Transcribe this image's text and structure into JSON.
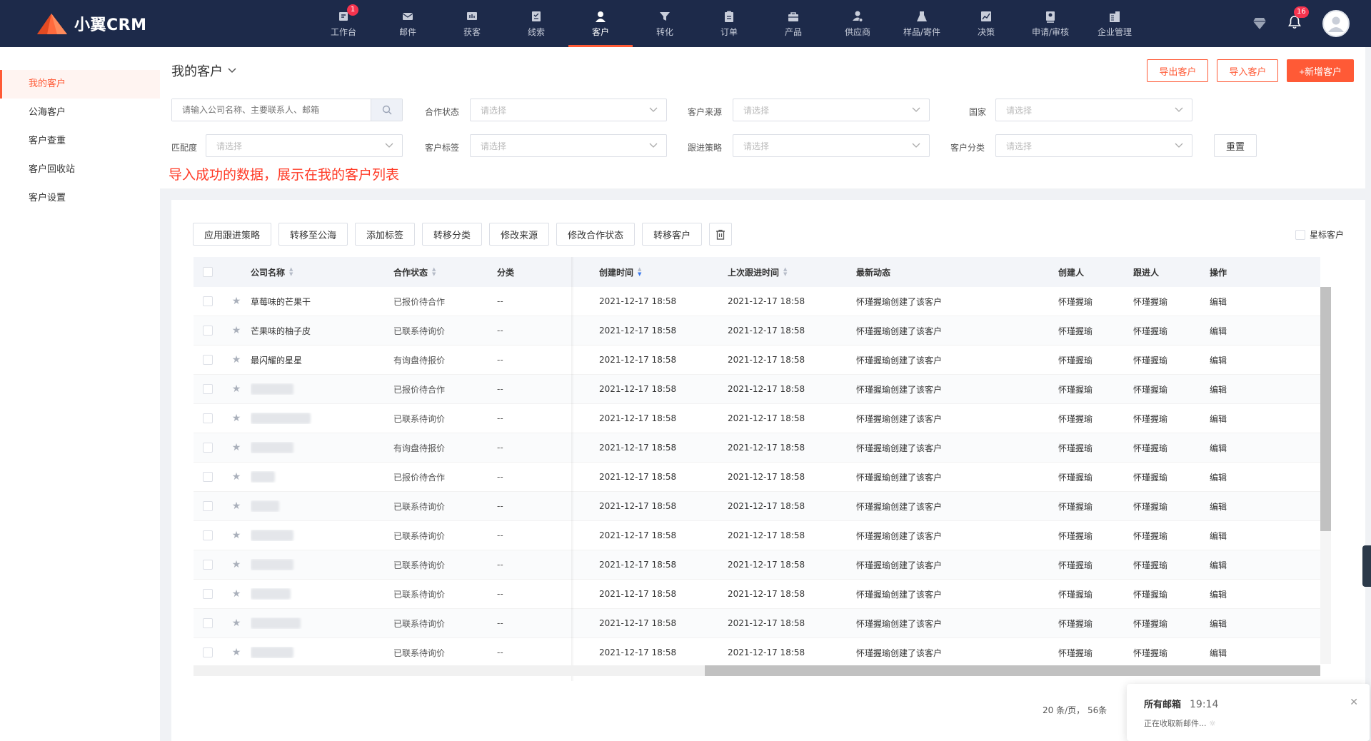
{
  "app": {
    "logo_text": "小翼CRM"
  },
  "nav": {
    "items": [
      {
        "key": "workbench",
        "label": "工作台",
        "icon": "workbench-icon",
        "badge": "1"
      },
      {
        "key": "mail",
        "label": "邮件",
        "icon": "mail-icon"
      },
      {
        "key": "acquire",
        "label": "获客",
        "icon": "acquire-icon"
      },
      {
        "key": "leads",
        "label": "线索",
        "icon": "leads-icon"
      },
      {
        "key": "customer",
        "label": "客户",
        "icon": "user-icon",
        "active": true
      },
      {
        "key": "convert",
        "label": "转化",
        "icon": "funnel-icon"
      },
      {
        "key": "orders",
        "label": "订单",
        "icon": "clipboard-icon"
      },
      {
        "key": "products",
        "label": "产品",
        "icon": "bag-icon"
      },
      {
        "key": "suppliers",
        "label": "供应商",
        "icon": "supplier-icon"
      },
      {
        "key": "samples",
        "label": "样品/寄件",
        "icon": "flask-icon"
      },
      {
        "key": "decision",
        "label": "决策",
        "icon": "chart-icon"
      },
      {
        "key": "approval",
        "label": "申请/审核",
        "icon": "approval-icon"
      },
      {
        "key": "enterprise",
        "label": "企业管理",
        "icon": "building-icon"
      }
    ],
    "bell_badge": "16"
  },
  "sidebar": {
    "items": [
      {
        "label": "我的客户",
        "active": true
      },
      {
        "label": "公海客户"
      },
      {
        "label": "客户查重"
      },
      {
        "label": "客户回收站"
      },
      {
        "label": "客户设置"
      }
    ]
  },
  "header": {
    "title": "我的客户",
    "export_label": "导出客户",
    "import_label": "导入客户",
    "add_label": "+新增客户"
  },
  "filters": {
    "search_placeholder": "请输入公司名称、主要联系人、邮箱",
    "select_placeholder": "请选择",
    "coop_status": "合作状态",
    "source": "客户来源",
    "country": "国家",
    "match": "匹配度",
    "tags": "客户标签",
    "strategy": "跟进策略",
    "category": "客户分类",
    "reset": "重置"
  },
  "note": "导入成功的数据，展示在我的客户列表",
  "actions": {
    "apply_strategy": "应用跟进策略",
    "to_public": "转移至公海",
    "add_tag": "添加标签",
    "move_category": "转移分类",
    "edit_source": "修改来源",
    "edit_status": "修改合作状态",
    "transfer": "转移客户",
    "star_filter": "星标客户"
  },
  "table": {
    "columns": {
      "company": "公司名称",
      "status": "合作状态",
      "category": "分类",
      "created": "创建时间",
      "last_follow": "上次跟进时间",
      "latest": "最新动态",
      "creator": "创建人",
      "follower": "跟进人",
      "ops": "操作"
    },
    "rows": [
      {
        "company": "草莓味的芒果干",
        "status": "已报价待合作",
        "category": "--",
        "created": "2021-12-17 18:58",
        "last_follow": "2021-12-17 18:58",
        "latest": "怀瑾握瑜创建了该客户",
        "creator": "怀瑾握瑜",
        "follower": "怀瑾握瑜",
        "op": "编辑"
      },
      {
        "company": "芒果味的柚子皮",
        "status": "已联系待询价",
        "category": "--",
        "created": "2021-12-17 18:58",
        "last_follow": "2021-12-17 18:58",
        "latest": "怀瑾握瑜创建了该客户",
        "creator": "怀瑾握瑜",
        "follower": "怀瑾握瑜",
        "op": "编辑"
      },
      {
        "company": "最闪耀的星星",
        "status": "有询盘待报价",
        "category": "--",
        "created": "2021-12-17 18:58",
        "last_follow": "2021-12-17 18:58",
        "latest": "怀瑾握瑜创建了该客户",
        "creator": "怀瑾握瑜",
        "follower": "怀瑾握瑜",
        "op": "编辑"
      },
      {
        "company": "",
        "status": "已报价待合作",
        "category": "--",
        "created": "2021-12-17 18:58",
        "last_follow": "2021-12-17 18:58",
        "latest": "怀瑾握瑜创建了该客户",
        "creator": "怀瑾握瑜",
        "follower": "怀瑾握瑜",
        "op": "编辑"
      },
      {
        "company": "",
        "status": "已联系待询价",
        "category": "--",
        "created": "2021-12-17 18:58",
        "last_follow": "2021-12-17 18:58",
        "latest": "怀瑾握瑜创建了该客户",
        "creator": "怀瑾握瑜",
        "follower": "怀瑾握瑜",
        "op": "编辑"
      },
      {
        "company": "",
        "status": "有询盘待报价",
        "category": "--",
        "created": "2021-12-17 18:58",
        "last_follow": "2021-12-17 18:58",
        "latest": "怀瑾握瑜创建了该客户",
        "creator": "怀瑾握瑜",
        "follower": "怀瑾握瑜",
        "op": "编辑"
      },
      {
        "company": "",
        "status": "已报价待合作",
        "category": "--",
        "created": "2021-12-17 18:58",
        "last_follow": "2021-12-17 18:58",
        "latest": "怀瑾握瑜创建了该客户",
        "creator": "怀瑾握瑜",
        "follower": "怀瑾握瑜",
        "op": "编辑"
      },
      {
        "company": "",
        "status": "已联系待询价",
        "category": "--",
        "created": "2021-12-17 18:58",
        "last_follow": "2021-12-17 18:58",
        "latest": "怀瑾握瑜创建了该客户",
        "creator": "怀瑾握瑜",
        "follower": "怀瑾握瑜",
        "op": "编辑"
      },
      {
        "company": "",
        "status": "已联系待询价",
        "category": "--",
        "created": "2021-12-17 18:58",
        "last_follow": "2021-12-17 18:58",
        "latest": "怀瑾握瑜创建了该客户",
        "creator": "怀瑾握瑜",
        "follower": "怀瑾握瑜",
        "op": "编辑"
      },
      {
        "company": "",
        "status": "已联系待询价",
        "category": "--",
        "created": "2021-12-17 18:58",
        "last_follow": "2021-12-17 18:58",
        "latest": "怀瑾握瑜创建了该客户",
        "creator": "怀瑾握瑜",
        "follower": "怀瑾握瑜",
        "op": "编辑"
      },
      {
        "company": "",
        "status": "已联系待询价",
        "category": "--",
        "created": "2021-12-17 18:58",
        "last_follow": "2021-12-17 18:58",
        "latest": "怀瑾握瑜创建了该客户",
        "creator": "怀瑾握瑜",
        "follower": "怀瑾握瑜",
        "op": "编辑"
      },
      {
        "company": "",
        "status": "已联系待询价",
        "category": "--",
        "created": "2021-12-17 18:58",
        "last_follow": "2021-12-17 18:58",
        "latest": "怀瑾握瑜创建了该客户",
        "creator": "怀瑾握瑜",
        "follower": "怀瑾握瑜",
        "op": "编辑"
      },
      {
        "company": "",
        "status": "已联系待询价",
        "category": "--",
        "created": "2021-12-17 18:58",
        "last_follow": "2021-12-17 18:58",
        "latest": "怀瑾握瑜创建了该客户",
        "creator": "怀瑾握瑜",
        "follower": "怀瑾握瑜",
        "op": "编辑"
      }
    ]
  },
  "pager": {
    "text": "20 条/页， 56条"
  },
  "mail_popup": {
    "title": "所有邮箱",
    "time": "19:14",
    "status": "正在收取新邮件..."
  },
  "colors": {
    "accent": "#ff5a36",
    "nav_bg": "#1d2a4a",
    "note_red": "#ff3a26",
    "badge": "#f5334e"
  }
}
